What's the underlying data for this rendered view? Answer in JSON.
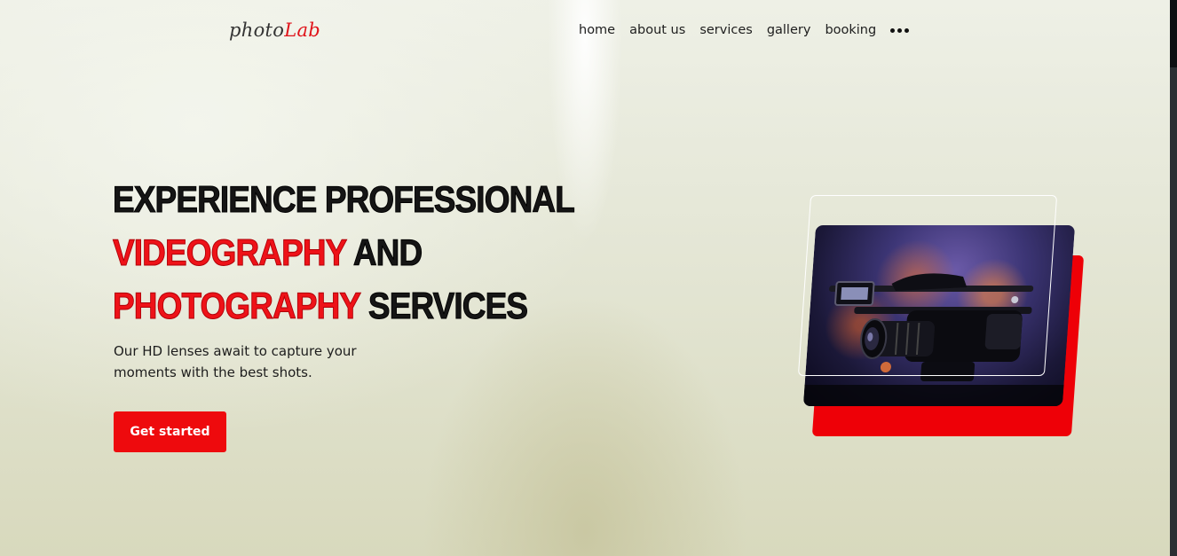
{
  "logo": {
    "part1": "photo",
    "part2": "Lab"
  },
  "nav": {
    "items": [
      "home",
      "about us",
      "services",
      "gallery",
      "booking"
    ],
    "more_icon": "ellipsis-icon"
  },
  "hero": {
    "line1": "EXPERIENCE PROFESSIONAL",
    "line2_red": "VIDEOGRAPHY",
    "line2_dark": "AND",
    "line3_red": "PHOTOGRAPHY",
    "line3_dark": "SERVICES",
    "subtitle": "Our HD lenses await to capture your moments with the best shots.",
    "cta_label": "Get started"
  },
  "colors": {
    "accent": "#ee0a0d",
    "text": "#151515"
  }
}
